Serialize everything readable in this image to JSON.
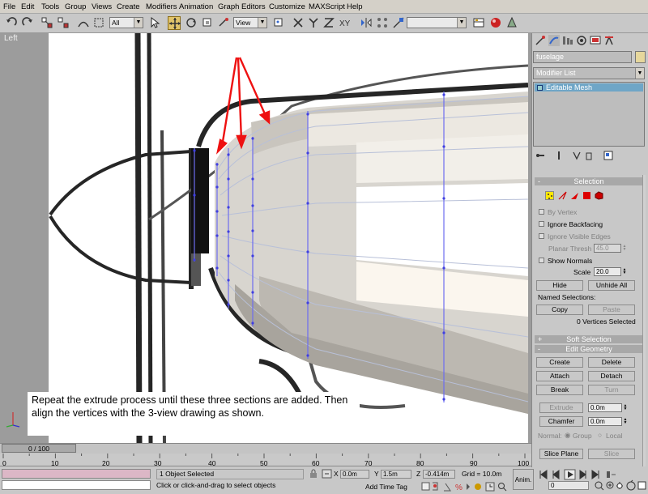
{
  "menu": [
    "File",
    "Edit",
    "Tools",
    "Group",
    "Views",
    "Create",
    "Modifiers",
    "Animation",
    "Graph Editors",
    "Customize",
    "MAXScript",
    "Help"
  ],
  "toolbar": {
    "selection_filter": "All",
    "ref_coord": "View",
    "named_selection": ""
  },
  "viewport": {
    "label": "Left",
    "annotation": "Repeat the extrude process until these three sections are added.  Then align the vertices with the 3-view drawing as shown."
  },
  "command_panel": {
    "object_name": "fuselage",
    "object_color": "#e6d79c",
    "modifier_list": "Modifier List",
    "stack_item": "Editable Mesh",
    "selection_rollout": "Selection",
    "by_vertex": "By Vertex",
    "ignore_backfacing": "Ignore Backfacing",
    "ignore_visible_edges": "Ignore Visible Edges",
    "planar_thresh_label": "Planar Thresh",
    "planar_thresh_value": "45.0",
    "show_normals": "Show Normals",
    "scale_label": "Scale",
    "scale_value": "20.0",
    "hide": "Hide",
    "unhide_all": "Unhide All",
    "named_selections": "Named Selections:",
    "copy": "Copy",
    "paste": "Paste",
    "vertices_selected": "0 Vertices Selected",
    "soft_selection": "Soft Selection",
    "edit_geometry": "Edit Geometry",
    "create": "Create",
    "delete": "Delete",
    "attach": "Attach",
    "detach": "Detach",
    "break": "Break",
    "turn": "Turn",
    "extrude": "Extrude",
    "extrude_value": "0.0m",
    "chamfer": "Chamfer",
    "chamfer_value": "0.0m",
    "normal_label": "Normal:",
    "group_label": "Group",
    "local_label": "Local",
    "slice_plane": "Slice Plane",
    "slice": "Slice"
  },
  "timeline": {
    "slider": "0 / 100",
    "ticks": [
      "0",
      "10",
      "20",
      "30",
      "40",
      "50",
      "60",
      "70",
      "80",
      "90",
      "100"
    ]
  },
  "status": {
    "selection": "1 Object Selected",
    "prompt": "Click or click-and-drag to select objects",
    "x_label": "X",
    "x_value": "0.0m",
    "y_label": "Y",
    "y_value": "1.5m",
    "z_label": "Z",
    "z_value": "-0.414m",
    "grid": "Grid = 10.0m",
    "add_time_tag": "Add Time Tag",
    "anim_button": "Anim.",
    "frame": "0"
  }
}
